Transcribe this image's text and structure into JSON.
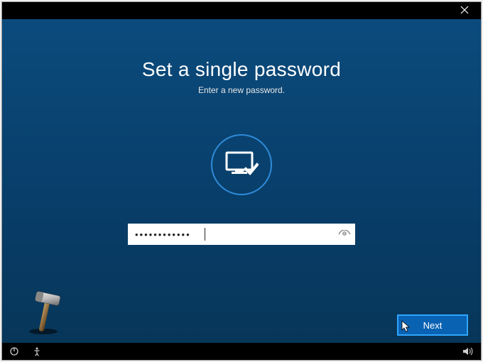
{
  "heading": "Set a single password",
  "subheading": "Enter a new password.",
  "password": {
    "value_masked": "••••••••••••",
    "placeholder": ""
  },
  "buttons": {
    "next": "Next"
  },
  "icons": {
    "close": "close-icon",
    "monitor_check": "monitor-check-icon",
    "reveal": "eye-icon",
    "power": "power-icon",
    "accessibility": "accessibility-icon",
    "volume": "volume-icon"
  },
  "colors": {
    "background": "#0b4b7d",
    "accent": "#2f8bd8",
    "button_bg": "#0a62b3",
    "button_border": "#2ea6ff"
  }
}
